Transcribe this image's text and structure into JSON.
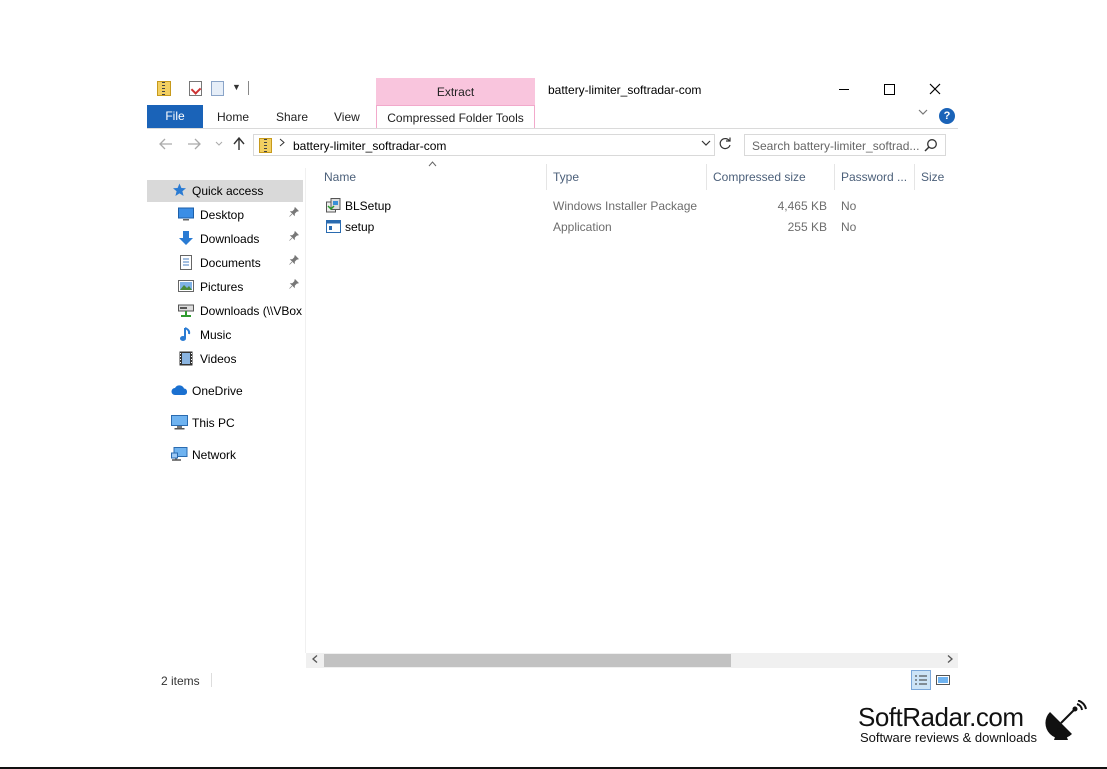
{
  "window": {
    "title": "battery-limiter_softradar-com",
    "contextual_group": "Extract"
  },
  "ribbon": {
    "tabs": [
      {
        "label": "File"
      },
      {
        "label": "Home"
      },
      {
        "label": "Share"
      },
      {
        "label": "View"
      },
      {
        "label": "Compressed Folder Tools"
      }
    ],
    "help_label": "?"
  },
  "address_bar": {
    "path": "battery-limiter_softradar-com",
    "search_placeholder": "Search battery-limiter_softrad..."
  },
  "sidebar": {
    "items": [
      {
        "label": "Quick access",
        "icon": "star-icon",
        "selected": true,
        "pinned": false
      },
      {
        "label": "Desktop",
        "icon": "desktop-icon",
        "pinned": true
      },
      {
        "label": "Downloads",
        "icon": "download-icon",
        "pinned": true
      },
      {
        "label": "Documents",
        "icon": "document-icon",
        "pinned": true
      },
      {
        "label": "Pictures",
        "icon": "pictures-icon",
        "pinned": true
      },
      {
        "label": "Downloads (\\\\VBox",
        "icon": "network-drive-icon",
        "pinned": false
      },
      {
        "label": "Music",
        "icon": "music-icon",
        "pinned": false
      },
      {
        "label": "Videos",
        "icon": "videos-icon",
        "pinned": false
      },
      {
        "label": "OneDrive",
        "icon": "cloud-icon"
      },
      {
        "label": "This PC",
        "icon": "computer-icon"
      },
      {
        "label": "Network",
        "icon": "network-icon"
      }
    ]
  },
  "file_list": {
    "columns": [
      "Name",
      "Type",
      "Compressed size",
      "Password ...",
      "Size"
    ],
    "rows": [
      {
        "name": "BLSetup",
        "type": "Windows Installer Package",
        "compressed_size": "4,465 KB",
        "password": "No",
        "icon": "installer-icon"
      },
      {
        "name": "setup",
        "type": "Application",
        "compressed_size": "255 KB",
        "password": "No",
        "icon": "application-icon"
      }
    ]
  },
  "status_bar": {
    "items_count": "2 items"
  },
  "watermark": {
    "brand": "SoftRadar.com",
    "tagline": "Software reviews & downloads"
  },
  "colors": {
    "accent": "#1a63b8",
    "contextual_tab": "#f9c5dd",
    "selected_nav": "#d9d9d9",
    "header_text": "#4c607a"
  }
}
